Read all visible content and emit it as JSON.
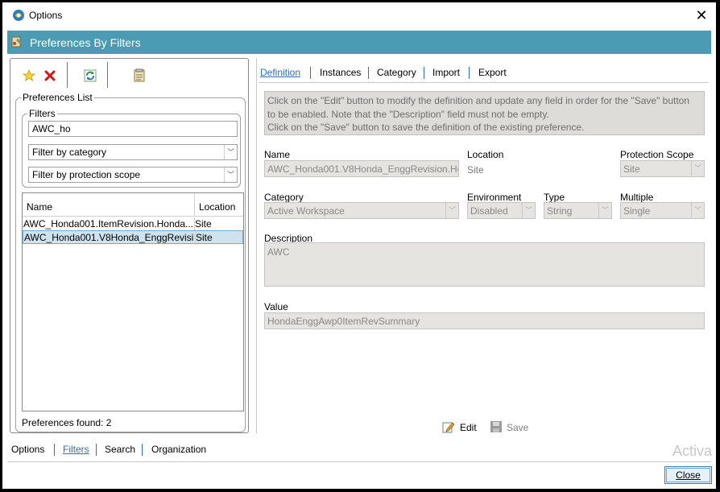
{
  "window": {
    "title": "Options",
    "close_glyph": "✕"
  },
  "banner": {
    "title": "Preferences By Filters"
  },
  "left": {
    "toolbar": {
      "add_icon": "star-add-icon",
      "delete_icon": "red-x-delete-icon",
      "refresh_icon": "refresh-icon",
      "report_icon": "document-icon"
    },
    "preferences_list_label": "Preferences List",
    "filters_label": "Filters",
    "filter_text": "AWC_ho",
    "filter_category": "Filter by category",
    "filter_scope": "Filter by protection scope",
    "columns": {
      "name": "Name",
      "location": "Location"
    },
    "rows": [
      {
        "name": "AWC_Honda001.ItemRevision.Honda....",
        "location": "Site",
        "selected": false
      },
      {
        "name": "AWC_Honda001.V8Honda_EnggRevisi...",
        "location": "Site",
        "selected": true
      }
    ],
    "found_text": "Preferences found: 2"
  },
  "right": {
    "tabs": [
      "Definition",
      "Instances",
      "Category",
      "Import",
      "Export"
    ],
    "active_tab": "Definition",
    "info_line1": "Click on the \"Edit\" button to modify the definition and update any field in order for the \"Save\" button",
    "info_line2": "to be enabled. Note that the \"Description\" field must not be empty.",
    "info_line3": "Click on the \"Save\" button to save the definition of the existing preference.",
    "name_label": "Name",
    "name_value": "AWC_Honda001.V8Honda_EnggRevision.Hor",
    "location_label": "Location",
    "location_value": "Site",
    "protection_label": "Protection Scope",
    "protection_value": "Site",
    "category_label": "Category",
    "category_value": "Active Workspace",
    "environment_label": "Environment",
    "environment_value": "Disabled",
    "type_label": "Type",
    "type_value": "String",
    "multiple_label": "Multiple",
    "multiple_value": "Single",
    "description_label": "Description",
    "description_value": "AWC",
    "value_label": "Value",
    "value_value": "HondaEnggAwp0ItemRevSummary",
    "edit_label": "Edit",
    "save_label": "Save"
  },
  "bottom": {
    "tabs": [
      "Options",
      "Filters",
      "Search",
      "Organization"
    ],
    "active_tab": "Filters",
    "watermark": "Activa",
    "close_label": "Close"
  },
  "colors": {
    "banner": "#4a9bb3",
    "link": "#2a6fb8",
    "selected_row": "#cfe3ef",
    "disabled_field": "#e6e4e0"
  }
}
